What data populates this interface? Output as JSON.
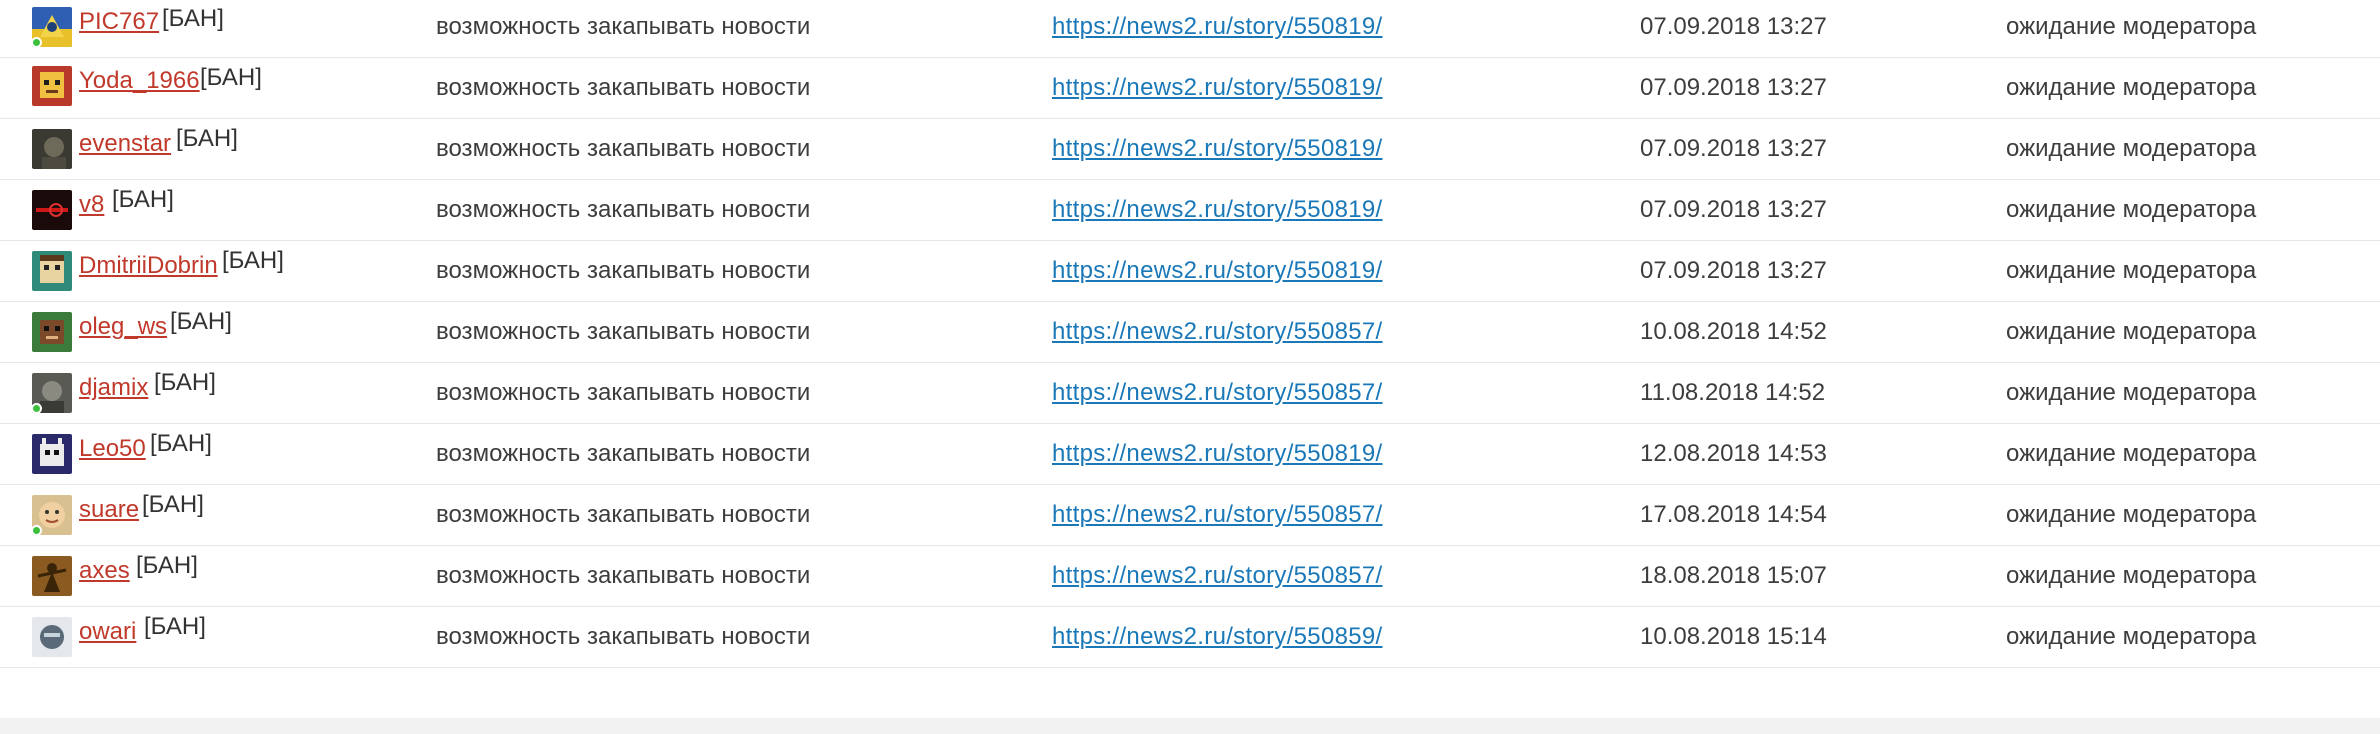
{
  "rows": [
    {
      "username": "PIC767",
      "ban": "[БАН]",
      "action": "возможность закапывать новости",
      "link": "https://news2.ru/story/550819/",
      "date": "07.09.2018 13:27",
      "status": "ожидание модератора",
      "online": true
    },
    {
      "username": "Yoda_1966",
      "ban": "[БАН]",
      "action": "возможность закапывать новости",
      "link": "https://news2.ru/story/550819/",
      "date": "07.09.2018 13:27",
      "status": "ожидание модератора",
      "online": false
    },
    {
      "username": "evenstar",
      "ban": "[БАН]",
      "action": "возможность закапывать новости",
      "link": "https://news2.ru/story/550819/",
      "date": "07.09.2018 13:27",
      "status": "ожидание модератора",
      "online": false
    },
    {
      "username": "v8",
      "ban": "[БАН]",
      "action": "возможность закапывать новости",
      "link": "https://news2.ru/story/550819/",
      "date": "07.09.2018 13:27",
      "status": "ожидание модератора",
      "online": false
    },
    {
      "username": "DmitriiDobrin",
      "ban": "[БАН]",
      "action": "возможность закапывать новости",
      "link": "https://news2.ru/story/550819/",
      "date": "07.09.2018 13:27",
      "status": "ожидание модератора",
      "online": false
    },
    {
      "username": "oleg_ws",
      "ban": "[БАН]",
      "action": "возможность закапывать новости",
      "link": "https://news2.ru/story/550857/",
      "date": "10.08.2018 14:52",
      "status": "ожидание модератора",
      "online": false
    },
    {
      "username": "djamix",
      "ban": "[БАН]",
      "action": "возможность закапывать новости",
      "link": "https://news2.ru/story/550857/",
      "date": "11.08.2018 14:52",
      "status": "ожидание модератора",
      "online": true
    },
    {
      "username": "Leo50",
      "ban": "[БАН]",
      "action": "возможность закапывать новости",
      "link": "https://news2.ru/story/550819/",
      "date": "12.08.2018 14:53",
      "status": "ожидание модератора",
      "online": false
    },
    {
      "username": "suare",
      "ban": "[БАН]",
      "action": "возможность закапывать новости",
      "link": "https://news2.ru/story/550857/",
      "date": "17.08.2018 14:54",
      "status": "ожидание модератора",
      "online": true
    },
    {
      "username": "axes",
      "ban": "[БАН]",
      "action": "возможность закапывать новости",
      "link": "https://news2.ru/story/550857/",
      "date": "18.08.2018 15:07",
      "status": "ожидание модератора",
      "online": false
    },
    {
      "username": "owari",
      "ban": "[БАН]",
      "action": "возможность закапывать новости",
      "link": "https://news2.ru/story/550859/",
      "date": "10.08.2018 15:14",
      "status": "ожидание модератора",
      "online": false
    }
  ]
}
